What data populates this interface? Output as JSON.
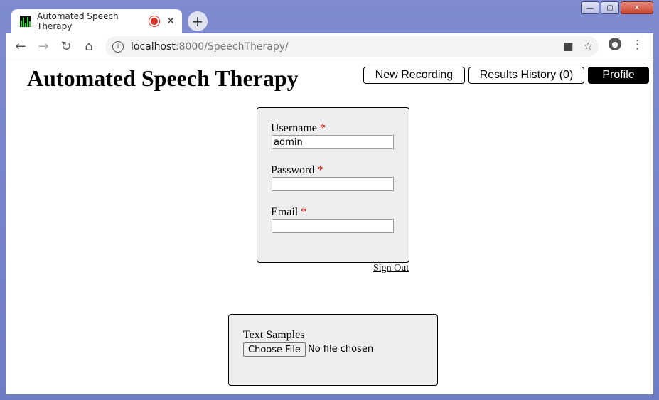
{
  "browser": {
    "tab_title": "Automated Speech Therapy",
    "new_tab": "+",
    "tab_close": "✕",
    "url_host": "localhost",
    "url_path": ":8000/SpeechTherapy/",
    "window_buttons": [
      "—",
      "▢",
      "✕"
    ]
  },
  "header": {
    "title": "Automated Speech Therapy",
    "nav": [
      {
        "label": "New Recording"
      },
      {
        "label": "Results History (0)"
      },
      {
        "label": "Profile",
        "active": true
      }
    ]
  },
  "profile_form": {
    "required_marker": "*",
    "username_label": "Username",
    "username_value": "admin",
    "password_label": "Password",
    "password_value": "",
    "email_label": "Email",
    "email_value": ""
  },
  "sign_out": "Sign Out",
  "upload": {
    "label": "Text Samples",
    "button": "Choose File",
    "status": "No file chosen"
  },
  "colors": {
    "active_nav_bg": "#000000",
    "required": "#dd0000",
    "card_bg": "#eeeeee"
  }
}
